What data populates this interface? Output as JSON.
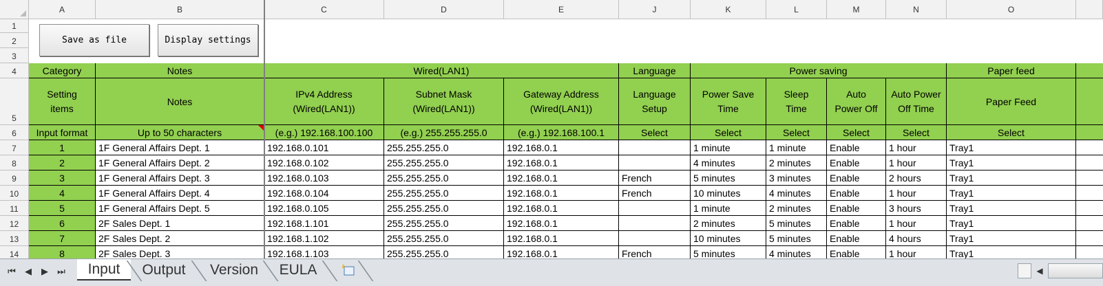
{
  "columns": [
    "A",
    "B",
    "C",
    "D",
    "E",
    "J",
    "K",
    "L",
    "M",
    "N",
    "O"
  ],
  "row_numbers": [
    "1",
    "2",
    "3",
    "4",
    "5",
    "6",
    "7",
    "8",
    "9",
    "10",
    "11",
    "12",
    "13",
    "14"
  ],
  "buttons": {
    "save": "Save as file",
    "display": "Display settings"
  },
  "headers": {
    "row4": {
      "category": "Category",
      "notes": "Notes",
      "wired": "Wired(LAN1)",
      "language": "Language",
      "power": "Power saving",
      "paper": "Paper feed"
    },
    "row5": {
      "setting_items": "Setting items",
      "notes": "Notes",
      "ipv4": "IPv4 Address (Wired(LAN1))",
      "subnet": "Subnet Mask (Wired(LAN1))",
      "gateway": "Gateway Address (Wired(LAN1))",
      "language_setup": "Language Setup",
      "power_save_time": "Power Save Time",
      "sleep_time": "Sleep Time",
      "auto_power_off": "Auto Power Off",
      "auto_power_off_time": "Auto Power Off Time",
      "paper_feed": "Paper Feed"
    },
    "row6": {
      "input_format": "Input format",
      "notes": "Up to 50 characters",
      "ipv4": "(e.g.) 192.168.100.100",
      "subnet": "(e.g.) 255.255.255.0",
      "gateway": "(e.g.) 192.168.100.1",
      "language": "Select",
      "power_save": "Select",
      "sleep": "Select",
      "auto_off": "Select",
      "auto_off_time": "Select",
      "paper": "Select"
    }
  },
  "rows": [
    [
      "1",
      "1F General Affairs Dept. 1",
      "192.168.0.101",
      "255.255.255.0",
      "192.168.0.1",
      "",
      "1 minute",
      "1 minute",
      "Enable",
      "1 hour",
      "Tray1"
    ],
    [
      "2",
      "1F General Affairs Dept. 2",
      "192.168.0.102",
      "255.255.255.0",
      "192.168.0.1",
      "",
      "4 minutes",
      "2 minutes",
      "Enable",
      "1 hour",
      "Tray1"
    ],
    [
      "3",
      "1F General Affairs Dept. 3",
      "192.168.0.103",
      "255.255.255.0",
      "192.168.0.1",
      "French",
      "5 minutes",
      "3 minutes",
      "Enable",
      "2 hours",
      "Tray1"
    ],
    [
      "4",
      "1F General Affairs Dept. 4",
      "192.168.0.104",
      "255.255.255.0",
      "192.168.0.1",
      "French",
      "10 minutes",
      "4 minutes",
      "Enable",
      "1 hour",
      "Tray1"
    ],
    [
      "5",
      "1F General Affairs Dept. 5",
      "192.168.0.105",
      "255.255.255.0",
      "192.168.0.1",
      "",
      "1 minute",
      "2 minutes",
      "Enable",
      "3 hours",
      "Tray1"
    ],
    [
      "6",
      "2F Sales Dept. 1",
      "192.168.1.101",
      "255.255.255.0",
      "192.168.0.1",
      "",
      "2 minutes",
      "5 minutes",
      "Enable",
      "1 hour",
      "Tray1"
    ],
    [
      "7",
      "2F Sales Dept. 2",
      "192.168.1.102",
      "255.255.255.0",
      "192.168.0.1",
      "",
      "10 minutes",
      "5 minutes",
      "Enable",
      "4 hours",
      "Tray1"
    ],
    [
      "8",
      "2F Sales Dept. 3",
      "192.168.1.103",
      "255.255.255.0",
      "192.168.0.1",
      "French",
      "5 minutes",
      "4 minutes",
      "Enable",
      "1 hour",
      "Tray1"
    ]
  ],
  "sheet_tabs": [
    "Input",
    "Output",
    "Version",
    "EULA"
  ],
  "active_tab": "Input",
  "icons": {
    "first": "first-sheet-icon",
    "prev": "prev-sheet-icon",
    "next": "next-sheet-icon",
    "last": "last-sheet-icon",
    "new_sheet": "new-sheet-icon"
  },
  "colors": {
    "header_green": "#92d050",
    "comment_flag": "#e00000"
  }
}
